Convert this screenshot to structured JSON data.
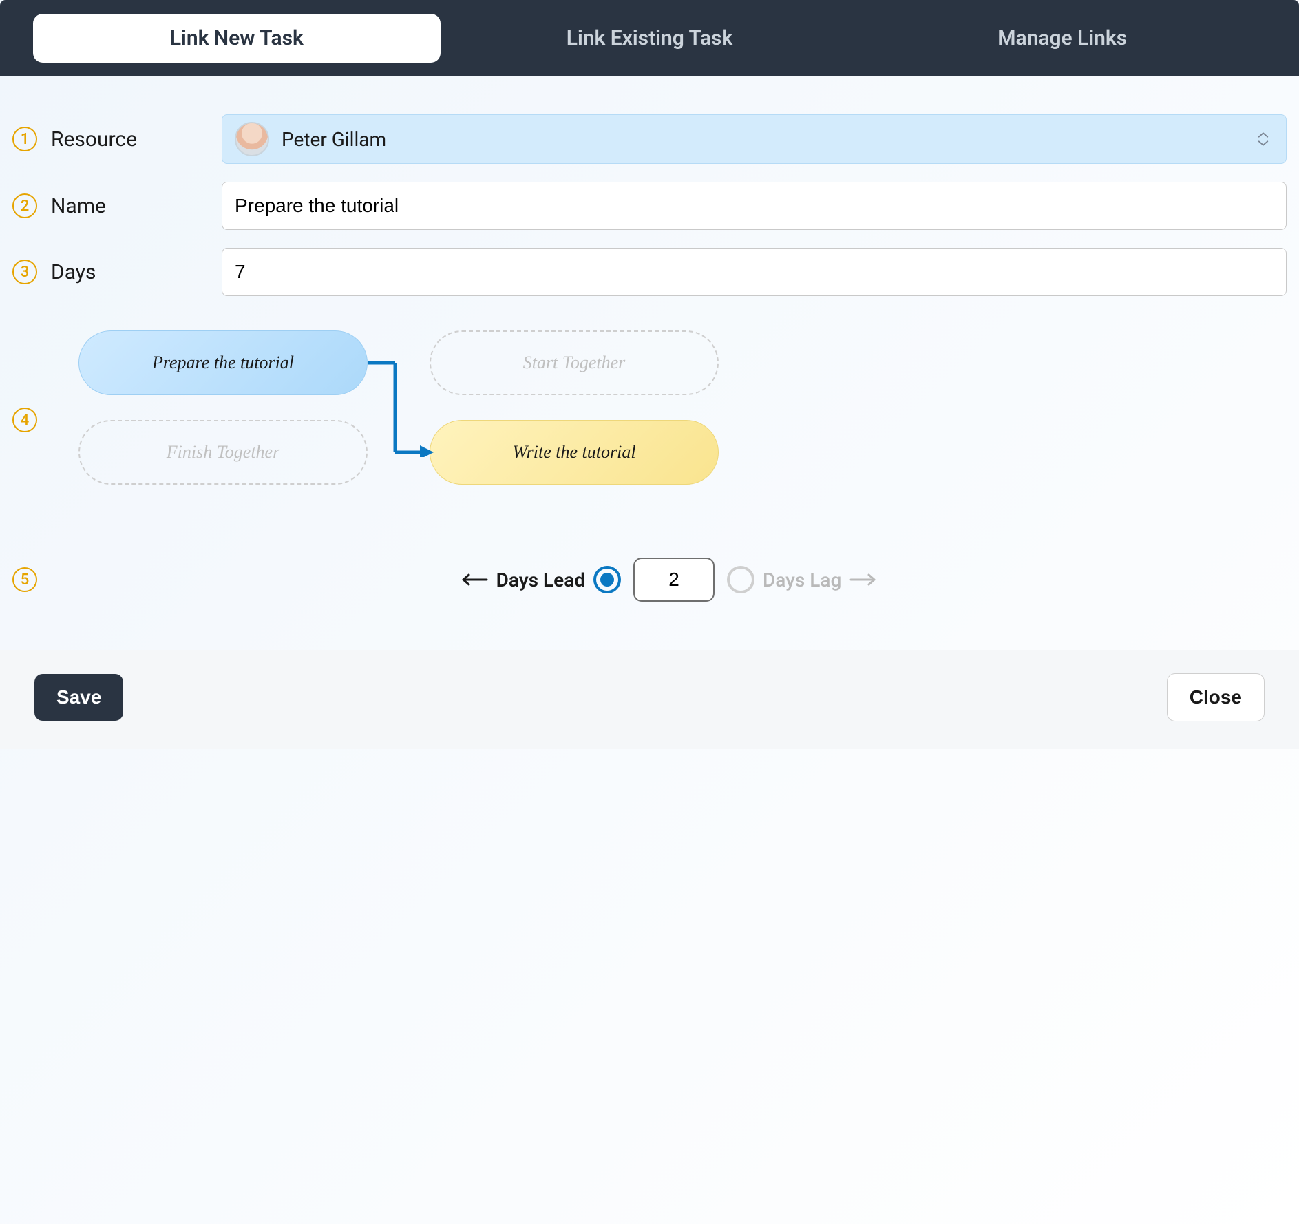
{
  "tabs": {
    "new": {
      "label": "Link New Task",
      "active": true
    },
    "existing": {
      "label": "Link Existing Task",
      "active": false
    },
    "manage": {
      "label": "Manage Links",
      "active": false
    }
  },
  "fields": {
    "resource": {
      "label": "Resource",
      "value": "Peter Gillam"
    },
    "name": {
      "label": "Name",
      "value": "Prepare the tutorial"
    },
    "days": {
      "label": "Days",
      "value": "7"
    }
  },
  "diagram": {
    "source": "Prepare the tutorial",
    "start_together": "Start Together",
    "finish_together": "Finish Together",
    "target": "Write the tutorial"
  },
  "offset": {
    "lead_label": "Days Lead",
    "lag_label": "Days Lag",
    "value": "2",
    "selected": "lead"
  },
  "footer": {
    "save": "Save",
    "close": "Close"
  },
  "steps": {
    "1": "1",
    "2": "2",
    "3": "3",
    "4": "4",
    "5": "5"
  }
}
